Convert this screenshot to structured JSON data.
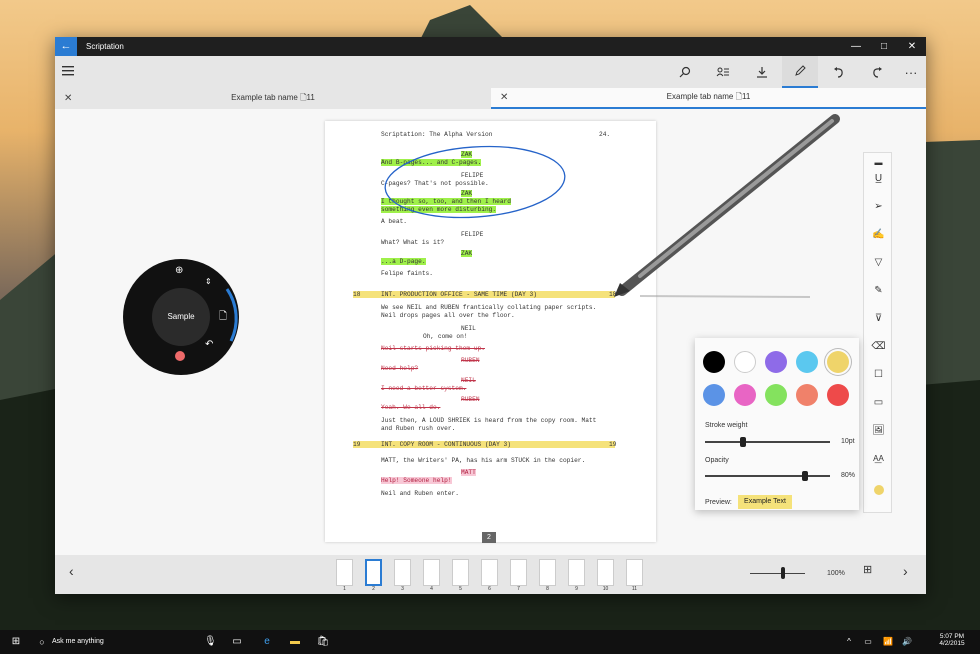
{
  "window": {
    "title": "Scriptation"
  },
  "titlebar": {
    "back": "←",
    "minimize": "—",
    "maximize": "□",
    "close": "✕"
  },
  "toolbar": {
    "icons": [
      "menu-icon",
      "search-icon",
      "characters-icon",
      "download-icon",
      "pen-icon",
      "undo-icon",
      "redo-icon",
      "more-icon"
    ],
    "more": "···"
  },
  "tabs": [
    {
      "label": "Example tab name",
      "count": "11"
    },
    {
      "label": "Example tab name",
      "count": "11"
    }
  ],
  "page": {
    "header": "Scriptation: The Alpha Version",
    "page_no": "24.",
    "lines": [
      {
        "t": "ZAK",
        "c": "hl-g"
      },
      {
        "t": "And B-pages... and C-pages.",
        "c": "hl-g"
      },
      {
        "t": "FELIPE",
        "c": ""
      },
      {
        "t": "C-pages? That's not possible.",
        "c": ""
      },
      {
        "t": "ZAK",
        "c": "hl-g"
      },
      {
        "t": "I thought so, too, and then I heard",
        "c": "hl-g"
      },
      {
        "t": "something even more disturbing.",
        "c": "hl-g"
      },
      {
        "t": "A beat.",
        "c": ""
      },
      {
        "t": "FELIPE",
        "c": ""
      },
      {
        "t": "What? What is it?",
        "c": ""
      },
      {
        "t": "ZAK",
        "c": "hl-g"
      },
      {
        "t": "...a D-page.",
        "c": "hl-g"
      },
      {
        "t": "Felipe faints.",
        "c": ""
      },
      {
        "t": "INT. PRODUCTION OFFICE - SAME TIME (DAY 3)",
        "c": "hl-y",
        "n": "18"
      },
      {
        "t": "We see NEIL and RUBEN frantically collating paper scripts.",
        "c": ""
      },
      {
        "t": "Neil drops pages all over the floor.",
        "c": ""
      },
      {
        "t": "NEIL",
        "c": ""
      },
      {
        "t": "Oh, come on!",
        "c": ""
      },
      {
        "t": "Neil starts picking them up.",
        "c": "hl-r"
      },
      {
        "t": "RUBEN",
        "c": "hl-r"
      },
      {
        "t": "Need help?",
        "c": "hl-r"
      },
      {
        "t": "NEIL",
        "c": "hl-r"
      },
      {
        "t": "I need a better system.",
        "c": "hl-r"
      },
      {
        "t": "RUBEN",
        "c": "hl-r"
      },
      {
        "t": "Yeah. We all do.",
        "c": "hl-r"
      },
      {
        "t": "Just then, A LOUD SHRIEK is heard from the copy room. Matt",
        "c": ""
      },
      {
        "t": "and Ruben rush over.",
        "c": ""
      },
      {
        "t": "INT. COPY ROOM - CONTINUOUS (DAY 3)",
        "c": "hl-y",
        "n": "19"
      },
      {
        "t": "MATT, the Writers' PA, has his arm STUCK in the copier.",
        "c": ""
      },
      {
        "t": "MATT",
        "c": "hl-p"
      },
      {
        "t": "Help! Someone help!",
        "c": "hl-p"
      },
      {
        "t": "Neil and Ruben enter.",
        "c": ""
      }
    ],
    "footer_page": "2"
  },
  "radial": {
    "center": "Sample",
    "icons": [
      "zoom-in-icon",
      "up-down-icon",
      "page-icon",
      "undo-icon",
      "color-dot-icon"
    ]
  },
  "popup": {
    "colors": [
      "#000000",
      "#ffffff",
      "#8e6be8",
      "#5bc8ef",
      "#efd46a",
      "#5b93e6",
      "#e865c4",
      "#84e25e",
      "#f0816a",
      "#ee4a4a"
    ],
    "stroke_label": "Stroke weight",
    "stroke_value": "10pt",
    "stroke_level": 0.3,
    "opacity_label": "Opacity",
    "opacity_value": "80%",
    "opacity_level": 0.8,
    "preview_label": "Preview:",
    "preview_text": "Example Text"
  },
  "bottom": {
    "pages": [
      "1",
      "2",
      "3",
      "4",
      "5",
      "6",
      "7",
      "8",
      "9",
      "10",
      "11"
    ],
    "selected": "2",
    "zoom": "100%"
  },
  "taskbar": {
    "search": "Ask me anything",
    "time": "5:07 PM",
    "date": "4/2/2015"
  }
}
